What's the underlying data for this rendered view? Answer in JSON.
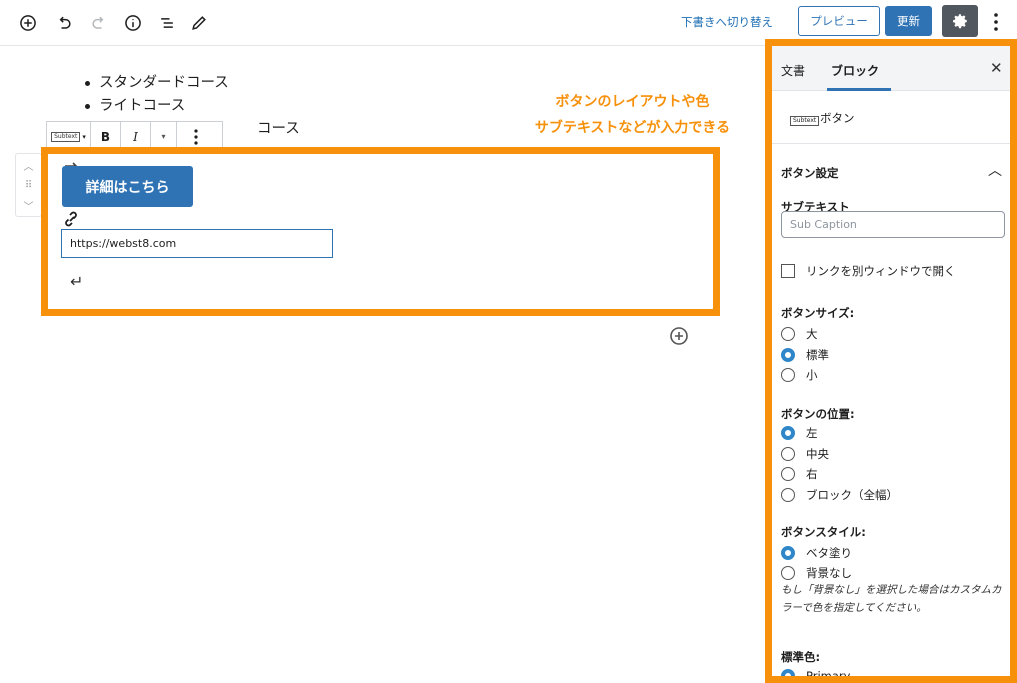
{
  "topbar": {
    "draft_link": "下書きへ切り替え",
    "preview_label": "プレビュー",
    "update_label": "更新"
  },
  "editor": {
    "list_items": [
      "スタンダードコース",
      "ライトコース",
      "コース"
    ],
    "toolbar": {
      "subtext_icon": "Subtext",
      "bold": "B",
      "italic": "I"
    },
    "button_text": "詳細はこちら",
    "url_value": "https://webst8.com",
    "callout_line1": "ボタンのレイアウトや色",
    "callout_line2": "サブテキストなどが入力できる"
  },
  "sidebar": {
    "tabs": [
      "文書",
      "ブロック"
    ],
    "block_icon": "Subtext",
    "block_name": "ボタン",
    "section_title": "ボタン設定",
    "subtext_label": "サブテキスト",
    "subtext_placeholder": "Sub Caption",
    "new_window_label": "リンクを別ウィンドウで開く",
    "size_label": "ボタンサイズ:",
    "size_options": [
      "大",
      "標準",
      "小"
    ],
    "size_selected": "標準",
    "position_label": "ボタンの位置:",
    "position_options": [
      "左",
      "中央",
      "右",
      "ブロック（全幅）"
    ],
    "position_selected": "左",
    "style_label": "ボタンスタイル:",
    "style_options": [
      "ベタ塗り",
      "背景なし"
    ],
    "style_selected": "ベタ塗り",
    "style_note": "もし「背景なし」を選択した場合はカスタムカラーで色を指定してください。",
    "color_label": "標準色:",
    "color_options": [
      "Primary"
    ]
  },
  "colors": {
    "accent": "#2f73b5",
    "highlight": "#f7900a"
  }
}
